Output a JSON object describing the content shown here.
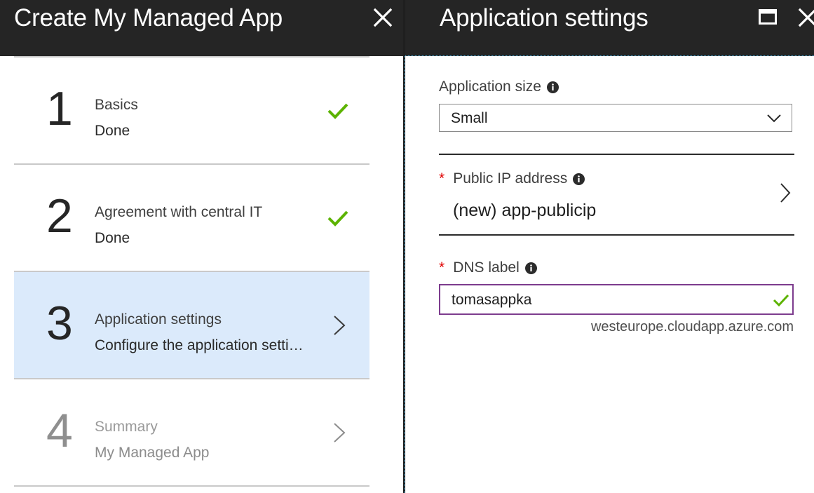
{
  "left_blade": {
    "title": "Create My Managed App",
    "steps": [
      {
        "number": "1",
        "title": "Basics",
        "subtitle": "Done",
        "status": "done"
      },
      {
        "number": "2",
        "title": "Agreement with central IT",
        "subtitle": "Done",
        "status": "done"
      },
      {
        "number": "3",
        "title": "Application settings",
        "subtitle": "Configure the application setti…",
        "status": "active"
      },
      {
        "number": "4",
        "title": "Summary",
        "subtitle": "My Managed App",
        "status": "disabled"
      }
    ]
  },
  "right_blade": {
    "title": "Application settings",
    "application_size": {
      "label": "Application size",
      "value": "Small"
    },
    "public_ip": {
      "label": "Public IP address",
      "value": "(new) app-publicip",
      "required": true
    },
    "dns_label": {
      "label": "DNS label",
      "value": "tomasappka",
      "suffix": "westeurope.cloudapp.azure.com",
      "required": true,
      "valid": true
    }
  },
  "colors": {
    "header_bg": "#252525",
    "active_step_bg": "#dbeafb",
    "check_green": "#5cb300",
    "required_red": "#e00000",
    "input_border_focus": "#7d3c8e"
  },
  "icons": {
    "close": "close-icon",
    "maximize": "maximize-icon",
    "check": "checkmark-icon",
    "chevron_right": "chevron-right-icon",
    "chevron_down": "chevron-down-icon",
    "info": "info-icon"
  }
}
